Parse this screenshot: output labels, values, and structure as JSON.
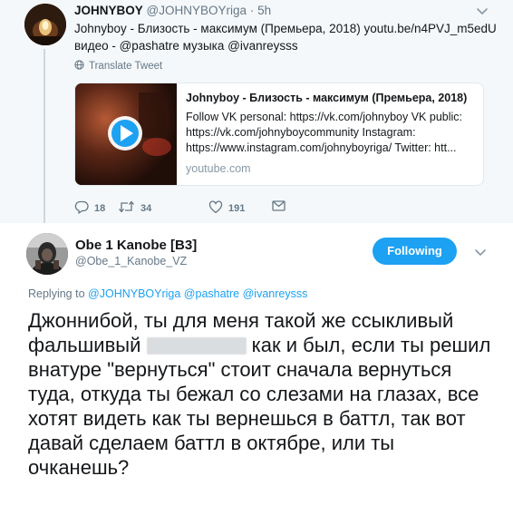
{
  "parent_tweet": {
    "name": "JOHNYBOY",
    "handle": "@JOHNYBOYriga",
    "separator": "·",
    "time": "5h",
    "text": "Johnyboy - Близость - максимум (Премьера, 2018) youtu.be/n4PVJ_m5edU видео - @pashatre музыка  @ivanreysss",
    "translate_label": "Translate Tweet",
    "card": {
      "title": "Johnyboy - Близость - максимум (Премьера, 2018)",
      "description": "Follow VK personal: https://vk.com/johnyboy VK public: https://vk.com/johnyboycommunity Instagram: https://www.instagram.com/johnyboyriga/ Twitter: htt...",
      "domain": "youtube.com"
    },
    "actions": {
      "replies": "18",
      "retweets": "34",
      "likes": "191"
    }
  },
  "main_tweet": {
    "name": "Obe 1 Kanobe [B3]",
    "handle": "@Obe_1_Kanobe_VZ",
    "follow_label": "Following",
    "replying_prefix": "Replying to",
    "replying_mentions": "@JOHNYBOYriga @pashatre @ivanreysss",
    "text_part1": "Джоннибой, ты для меня такой же ссыкливый фальшивый",
    "text_part2": "как и был, если ты решил внатуре \"вернуться\" стоит сначала вернуться туда, откуда ты бежал со слезами на глазах, все хотят видеть как ты вернешься в баттл, так вот давай сделаем баттл в октябре, или ты очканешь?"
  },
  "colors": {
    "accent": "#1da1f2",
    "muted": "#657786",
    "parent_bg": "#f5f8fa",
    "border": "#e1e8ed"
  },
  "icons": {
    "reply": "reply-icon",
    "retweet": "retweet-icon",
    "like": "heart-icon",
    "dm": "envelope-icon",
    "translate": "globe-icon",
    "play": "play-icon",
    "caret": "chevron-down-icon"
  }
}
